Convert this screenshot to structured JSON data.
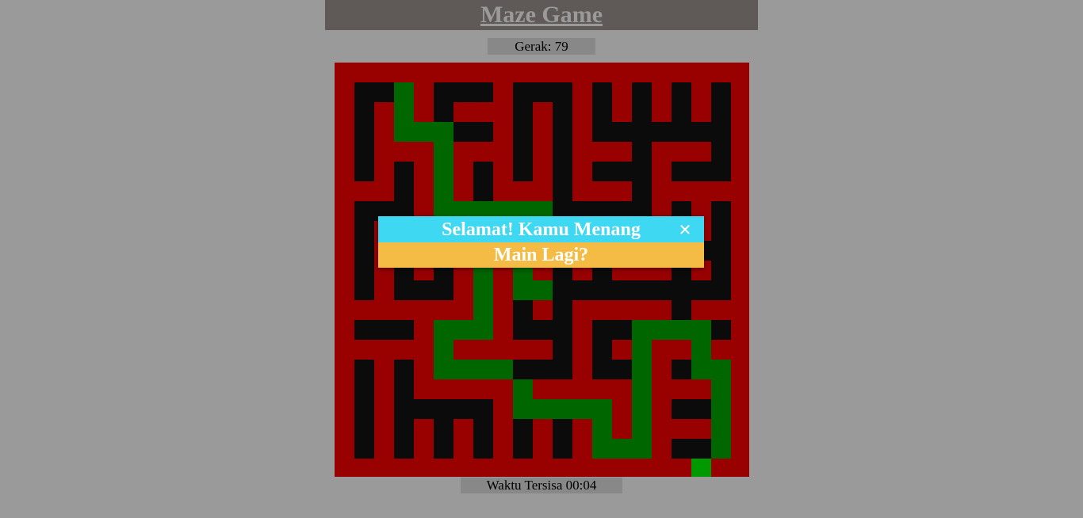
{
  "header": {
    "title": "Maze Game"
  },
  "status": {
    "moves_label": "Gerak: 79",
    "timer_label": "Waktu Tersisa 00:04"
  },
  "dialog": {
    "title": "Selamat! Kamu Menang",
    "close_symbol": "✕",
    "play_again_label": "Main Lagi?"
  },
  "colors": {
    "background": "#9a9a9a",
    "header": "#5f5a58",
    "wall": "#990000",
    "corridor": "#0b0b0b",
    "path": "#006600",
    "player": "#009900",
    "dialog_header": "#3fd8f2",
    "dialog_button": "#f4bc44"
  },
  "maze": {
    "rows": 21,
    "cols": 21,
    "legend": {
      "W": "wall",
      "B": "corridor",
      "G": "visited-path",
      "P": "player"
    },
    "grid": [
      "WWWWWWWWWWWWWWWWWWWWW",
      "WBBGWBBBWBBBWBWBWBWBW",
      "WBWGWBWWWBWBWBWBWBWBW",
      "WBWGGGBBWBWBWBBBBBBBW",
      "WBWWWGWWWBWBWWWBWWWBW",
      "WBWBWGWBWBWBWBBBWBBBW",
      "WWWBWGWBWWWBWWWBWWWWW",
      "WBBBWGGGGGGBBBBBWBWBW",
      "WBWBWWWWWGWBWWWWWBWBW",
      "WBWBBBBBWGWBBBBBWBBBW",
      "WBWBWBWGWGWBWBWWWBWBW",
      "WBWBBBWGWGGBBBBBBBBBW",
      "WWWWWWWGWBWBWWWWWBWWW",
      "WBBBWGGGWBBBWBBGGGGBW",
      "WWWWWGWWWWWBWBWGWWGWW",
      "WBWBWGGGGBBBWBBGWBGGW",
      "WBWBWWWWWGWWWWWGWWWGW",
      "WBWBBBBBWGGGGGWGWBBGW",
      "WBWBWBWBWBWBWGWGWWWGW",
      "WBWBWBWBWBWBWGGGWBBGW",
      "WWWWWWWWWWWWWWWWWWPWW"
    ]
  }
}
